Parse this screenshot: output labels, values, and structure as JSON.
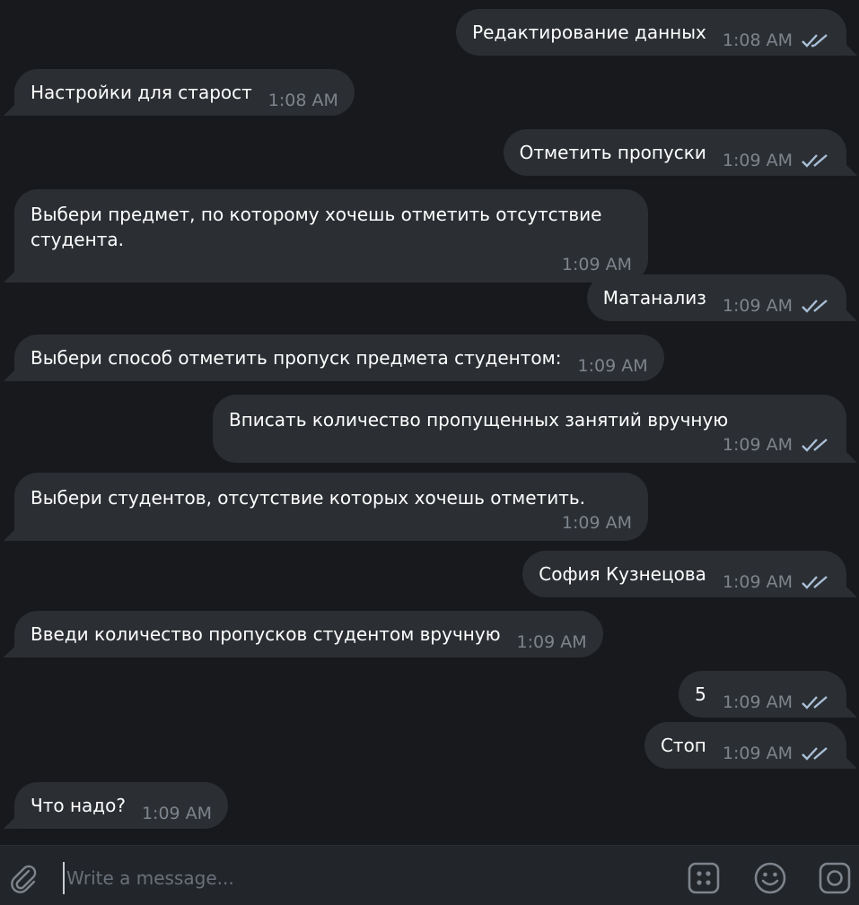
{
  "messages": [
    {
      "dir": "out",
      "text": "Редактирование данных",
      "time": "1:08 AM",
      "read": true
    },
    {
      "dir": "in",
      "text": "Настройки для старост",
      "time": "1:08 AM"
    },
    {
      "dir": "out",
      "text": "Отметить пропуски",
      "time": "1:09 AM",
      "read": true
    },
    {
      "dir": "in",
      "text": "Выбери предмет, по которому хочешь отметить отсутствие студента.",
      "time": "1:09 AM"
    },
    {
      "dir": "out",
      "text": "Матанализ",
      "time": "1:09 AM",
      "read": true
    },
    {
      "dir": "in",
      "text": "Выбери способ отметить пропуск предмета студентом:",
      "time": "1:09 AM"
    },
    {
      "dir": "out",
      "text": "Вписать количество пропущенных занятий вручную",
      "time": "1:09 AM",
      "read": true
    },
    {
      "dir": "in",
      "text": "Выбери студентов, отсутствие которых хочешь отметить.",
      "time": "1:09 AM"
    },
    {
      "dir": "out",
      "text": "София Кузнецова",
      "time": "1:09 AM",
      "read": true
    },
    {
      "dir": "in",
      "text": "Введи количество пропусков студентом вручную",
      "time": "1:09 AM"
    },
    {
      "dir": "out",
      "text": "5",
      "time": "1:09 AM",
      "read": true
    },
    {
      "dir": "out",
      "text": "Стоп",
      "time": "1:09 AM",
      "read": true
    },
    {
      "dir": "in",
      "text": "Что надо?",
      "time": "1:09 AM"
    }
  ],
  "composer": {
    "placeholder": "Write a message...",
    "value": "",
    "icons": [
      "paperclip-icon",
      "commands-icon",
      "emoji-icon",
      "camera-icon"
    ]
  },
  "colors": {
    "background": "#17191d",
    "bubble": "#2b2e33",
    "text": "#ffffff",
    "time": "#7e848c",
    "check": "#a9bfd6",
    "composer": "#22252a"
  }
}
